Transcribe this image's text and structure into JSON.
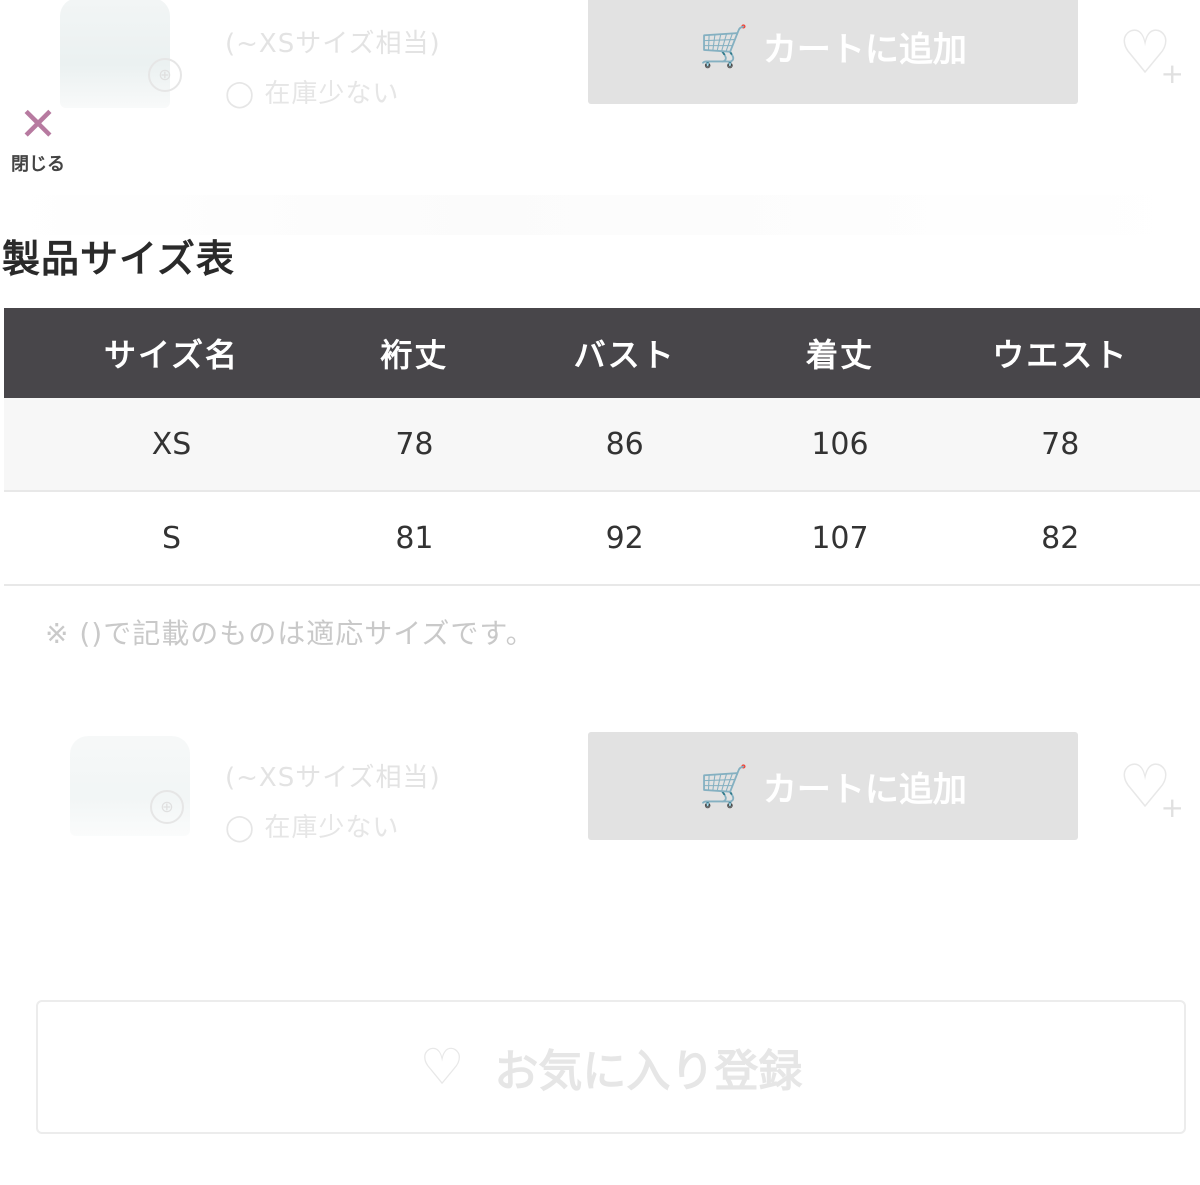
{
  "product_rows": [
    {
      "size_note": "(~XSサイズ相当)",
      "stock_note": "◯ 在庫少ない",
      "cart_label": "カートに追加"
    },
    {
      "size_note": "(~XSサイズ相当)",
      "stock_note": "◯ 在庫少ない",
      "cart_label": "カートに追加"
    }
  ],
  "close": {
    "label": "閉じる"
  },
  "size_table": {
    "title": "製品サイズ表",
    "headers": [
      "サイズ名",
      "裄丈",
      "バスト",
      "着丈",
      "ウエスト"
    ],
    "rows": [
      [
        "XS",
        "78",
        "86",
        "106",
        "78"
      ],
      [
        "S",
        "81",
        "92",
        "107",
        "82"
      ]
    ],
    "footnote": "※ ()で記載のものは適応サイズです。"
  },
  "favorite": {
    "label": "お気に入り登録"
  },
  "icons": {
    "cart": "cart-icon",
    "heart_plus": "heart-plus-icon",
    "close": "close-icon",
    "heart": "heart-icon"
  },
  "colors": {
    "table_header_bg": "#48464a",
    "close_x": "#b77aa0",
    "disabled_button": "#e2e2e2"
  }
}
